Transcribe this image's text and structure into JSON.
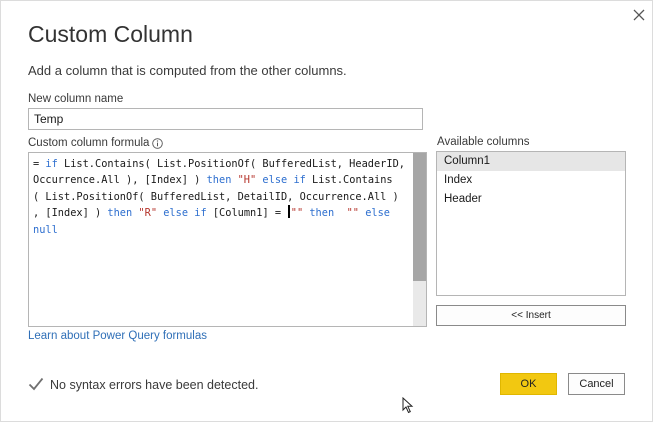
{
  "dialog": {
    "title": "Custom Column",
    "subtitle": "Add a column that is computed from the other columns.",
    "close_icon": "close-icon"
  },
  "new_column": {
    "label": "New column name",
    "value": "Temp"
  },
  "formula": {
    "label": "Custom column formula",
    "info_icon": "info-icon",
    "lines": [
      [
        {
          "t": "= ",
          "c": "plain"
        },
        {
          "t": "if",
          "c": "kw"
        },
        {
          "t": " List.Contains( List.PositionOf( BufferedList, HeaderID,",
          "c": "plain"
        }
      ],
      [
        {
          "t": "Occurrence.All ), [Index] ) ",
          "c": "plain"
        },
        {
          "t": "then",
          "c": "kw"
        },
        {
          "t": " ",
          "c": "plain"
        },
        {
          "t": "\"H\"",
          "c": "str"
        },
        {
          "t": " ",
          "c": "plain"
        },
        {
          "t": "else",
          "c": "kw"
        },
        {
          "t": " ",
          "c": "plain"
        },
        {
          "t": "if",
          "c": "kw"
        },
        {
          "t": " List.Contains",
          "c": "plain"
        }
      ],
      [
        {
          "t": "( List.PositionOf( BufferedList, DetailID, Occurrence.All )",
          "c": "plain"
        }
      ],
      [
        {
          "t": ", [Index] ) ",
          "c": "plain"
        },
        {
          "t": "then",
          "c": "kw"
        },
        {
          "t": " ",
          "c": "plain"
        },
        {
          "t": "\"R\"",
          "c": "str"
        },
        {
          "t": " ",
          "c": "plain"
        },
        {
          "t": "else",
          "c": "kw"
        },
        {
          "t": " ",
          "c": "plain"
        },
        {
          "t": "if",
          "c": "kw"
        },
        {
          "t": " [Column1] = ",
          "c": "plain"
        },
        {
          "t": "",
          "c": "caret"
        },
        {
          "t": "\"\"",
          "c": "str"
        },
        {
          "t": " ",
          "c": "plain"
        },
        {
          "t": "then",
          "c": "kw"
        },
        {
          "t": "  ",
          "c": "plain"
        },
        {
          "t": "\"\"",
          "c": "str"
        },
        {
          "t": " ",
          "c": "plain"
        },
        {
          "t": "else",
          "c": "kw"
        }
      ],
      [
        {
          "t": "null",
          "c": "kw"
        }
      ]
    ]
  },
  "learn_link": "Learn about Power Query formulas",
  "available_columns": {
    "label": "Available columns",
    "items": [
      "Column1",
      "Index",
      "Header"
    ],
    "selected_index": 0
  },
  "insert_label": "<< Insert",
  "status": {
    "icon": "checkmark-icon",
    "text": "No syntax errors have been detected."
  },
  "buttons": {
    "ok": "OK",
    "cancel": "Cancel"
  },
  "colors": {
    "ok_button": "#f2c811",
    "keyword": "#2e6fcf",
    "string": "#b5332a",
    "link": "#2f6fb7",
    "check": "#707070"
  }
}
